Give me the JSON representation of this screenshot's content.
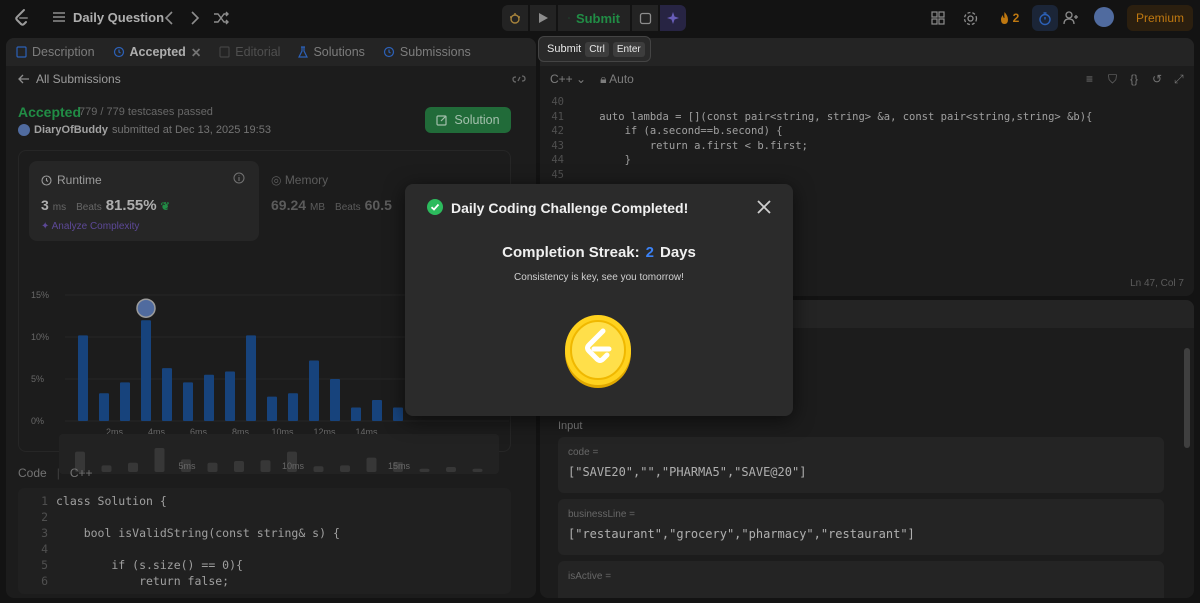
{
  "topbar": {
    "title": "Daily Question",
    "submit_label": "Submit",
    "streak_count": "2",
    "premium_label": "Premium"
  },
  "tooltip": {
    "label": "Submit",
    "key1": "Ctrl",
    "key2": "Enter"
  },
  "left": {
    "tabs": [
      {
        "label": "Description"
      },
      {
        "label": "Accepted"
      },
      {
        "label": "Editorial"
      },
      {
        "label": "Solutions"
      },
      {
        "label": "Submissions"
      }
    ],
    "back_label": "All Submissions",
    "status": "Accepted",
    "passed": "779 / 779 testcases passed",
    "user": "DiaryOfBuddy",
    "submitted_at": "submitted at Dec 13, 2025 19:53",
    "solution_btn": "Solution",
    "runtime": {
      "label": "Runtime",
      "value": "3",
      "unit": "ms",
      "beats_label": "Beats",
      "beats": "81.55%",
      "analyze": "Analyze Complexity"
    },
    "memory": {
      "label": "Memory",
      "value": "69.24",
      "unit": "MB",
      "beats_label": "Beats",
      "beats": "60.5"
    },
    "code_header": {
      "label": "Code",
      "lang": "C++"
    },
    "code_lines": [
      {
        "n": "1",
        "t": "class Solution {"
      },
      {
        "n": "2",
        "t": ""
      },
      {
        "n": "3",
        "t": "    bool isValidString(const string& s) {"
      },
      {
        "n": "4",
        "t": ""
      },
      {
        "n": "5",
        "t": "        if (s.size() == 0){"
      },
      {
        "n": "6",
        "t": "            return false;"
      }
    ]
  },
  "chart_data": {
    "type": "bar",
    "yticks": [
      "15%",
      "10%",
      "5%",
      "0%"
    ],
    "xticks": [
      "2ms",
      "4ms",
      "6ms",
      "8ms",
      "10ms",
      "12ms",
      "14ms"
    ],
    "ylim": [
      0,
      15
    ],
    "values": [
      10.2,
      3.3,
      4.6,
      12.0,
      6.3,
      4.6,
      5.5,
      5.9,
      10.2,
      2.9,
      3.3,
      7.2,
      5.0,
      1.6,
      2.5,
      1.6
    ],
    "highlight_index": 3,
    "mini_ticks": [
      "5ms",
      "10ms",
      "15ms"
    ]
  },
  "editor": {
    "lang": "C++",
    "mode": "Auto",
    "lines": [
      {
        "n": "40",
        "t": ""
      },
      {
        "n": "41",
        "t": "    auto lambda = [](const pair<string, string> &a, const pair<string,string> &b){"
      },
      {
        "n": "42",
        "t": "        if (a.second==b.second) {"
      },
      {
        "n": "43",
        "t": "            return a.first < b.first;"
      },
      {
        "n": "44",
        "t": "        }"
      },
      {
        "n": "45",
        "t": ""
      }
    ],
    "cursor": "Ln 47, Col 7"
  },
  "testcase": {
    "input_label": "Input",
    "cases": [
      {
        "label": "code =",
        "value": "[\"SAVE20\",\"\",\"PHARMA5\",\"SAVE@20\"]"
      },
      {
        "label": "businessLine =",
        "value": "[\"restaurant\",\"grocery\",\"pharmacy\",\"restaurant\"]"
      },
      {
        "label": "isActive =",
        "value": ""
      }
    ]
  },
  "modal": {
    "title": "Daily Coding Challenge Completed!",
    "streak_label": "Completion Streak:",
    "streak_value": "2",
    "streak_unit": "Days",
    "subtitle": "Consistency is key, see you tomorrow!"
  },
  "colors": {
    "accent_green": "#2cbb5d",
    "accent_blue": "#3b82f6",
    "brand_orange": "#ffa116",
    "bar_blue": "#1f5aa6"
  }
}
